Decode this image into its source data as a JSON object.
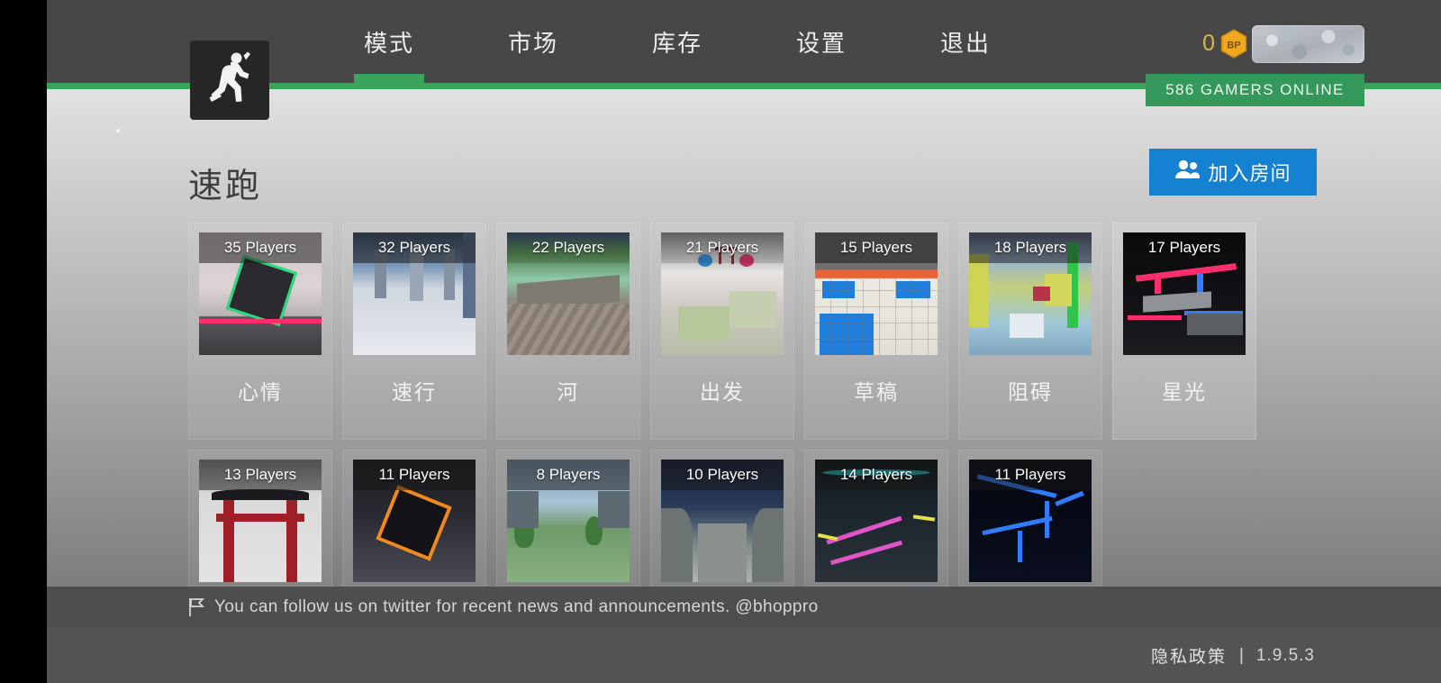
{
  "header": {
    "logo_icon": "running-man-icon",
    "nav": [
      {
        "label": "模式",
        "active": true
      },
      {
        "label": "市场",
        "active": false
      },
      {
        "label": "库存",
        "active": false
      },
      {
        "label": "设置",
        "active": false
      },
      {
        "label": "退出",
        "active": false
      }
    ],
    "currency": {
      "value": "0",
      "icon_label": "BP"
    },
    "avatar_placeholder": "loading-avatar",
    "gamers_online": "586 GAMERS ONLINE"
  },
  "main": {
    "page_title": "速跑",
    "join_room_label": "加入房间",
    "maps": [
      {
        "name": "心情",
        "players": "35 Players",
        "row": 1,
        "dim_band": false,
        "hovered": false
      },
      {
        "name": "速行",
        "players": "32 Players",
        "row": 1,
        "dim_band": false,
        "hovered": false
      },
      {
        "name": "河",
        "players": "22 Players",
        "row": 1,
        "dim_band": true,
        "hovered": false
      },
      {
        "name": "出发",
        "players": "21 Players",
        "row": 1,
        "dim_band": true,
        "hovered": false
      },
      {
        "name": "草稿",
        "players": "15 Players",
        "row": 1,
        "dim_band": false,
        "hovered": false
      },
      {
        "name": "阻碍",
        "players": "18 Players",
        "row": 1,
        "dim_band": false,
        "hovered": false
      },
      {
        "name": "星光",
        "players": "17 Players",
        "row": 1,
        "dim_band": true,
        "hovered": true
      },
      {
        "name": "",
        "players": "13 Players",
        "row": 2,
        "dim_band": false,
        "hovered": false
      },
      {
        "name": "",
        "players": "11 Players",
        "row": 2,
        "dim_band": false,
        "hovered": false
      },
      {
        "name": "",
        "players": "8 Players",
        "row": 2,
        "dim_band": false,
        "hovered": false
      },
      {
        "name": "",
        "players": "10 Players",
        "row": 2,
        "dim_band": false,
        "hovered": false
      },
      {
        "name": "",
        "players": "14 Players",
        "row": 2,
        "dim_band": false,
        "hovered": false
      },
      {
        "name": "",
        "players": "11 Players",
        "row": 2,
        "dim_band": false,
        "hovered": false
      }
    ]
  },
  "footer": {
    "twitter_message": "You can follow us on twitter for recent news and announcements. @bhoppro",
    "privacy_label": "隐私政策",
    "separator": "|",
    "version": "1.9.5.3"
  },
  "colors": {
    "header_bg": "#474747",
    "accent_green": "#3ba35c",
    "online_green": "#35985b",
    "join_blue": "#1582d1",
    "currency_gold": "#d8ba3f"
  }
}
